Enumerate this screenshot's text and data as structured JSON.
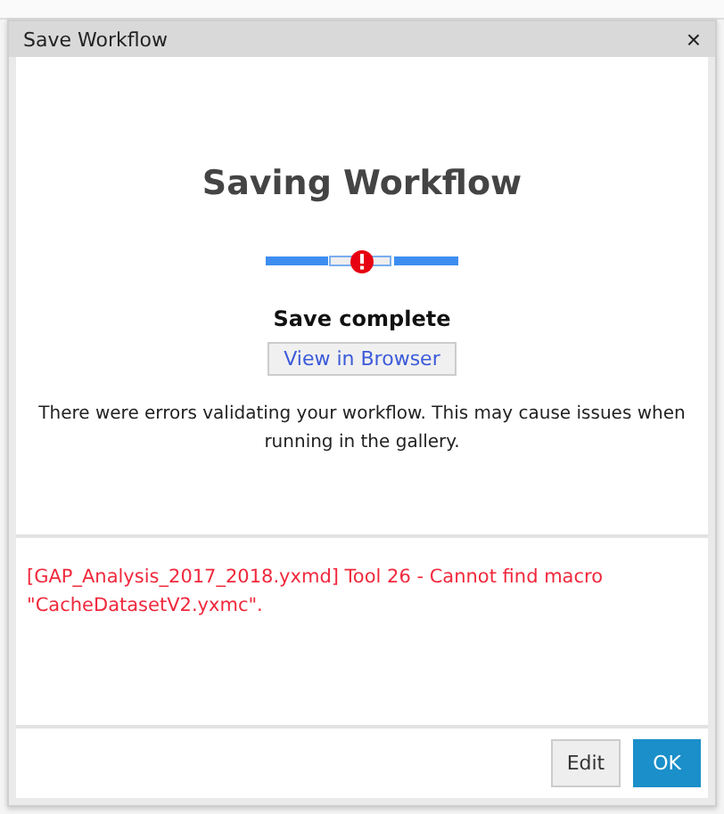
{
  "window": {
    "title": "Save Workflow",
    "close": "×"
  },
  "heading": "Saving Workflow",
  "status": "Save complete",
  "browser_button": "View in Browser",
  "message": "There were errors validating your workflow. This may cause issues when running in the gallery.",
  "errors": [
    "[GAP_Analysis_2017_2018.yxmd] Tool 26 - Cannot find macro \"CacheDatasetV2.yxmc\"."
  ],
  "buttons": [
    {
      "label": "Edit",
      "kind": "secondary"
    },
    {
      "label": "OK",
      "kind": "primary"
    }
  ]
}
